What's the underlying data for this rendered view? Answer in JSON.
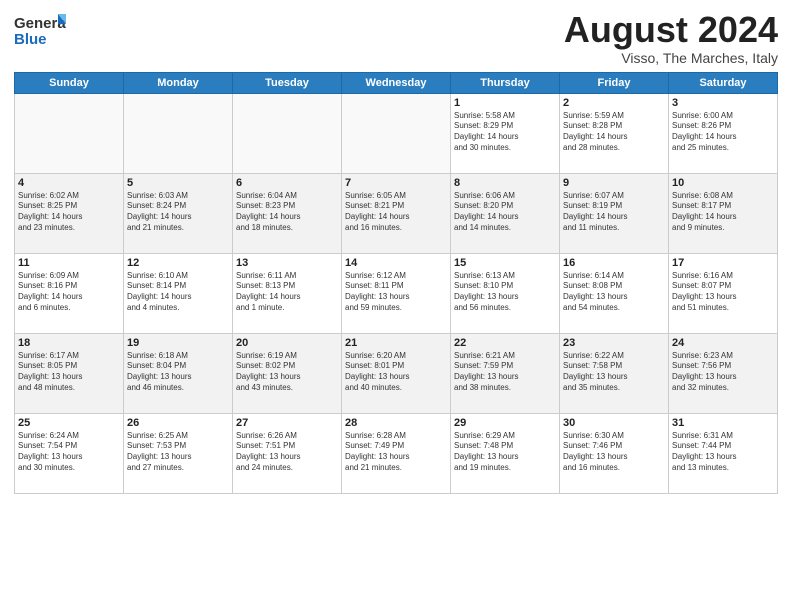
{
  "header": {
    "logo_general": "General",
    "logo_blue": "Blue",
    "month": "August 2024",
    "location": "Visso, The Marches, Italy"
  },
  "weekdays": [
    "Sunday",
    "Monday",
    "Tuesday",
    "Wednesday",
    "Thursday",
    "Friday",
    "Saturday"
  ],
  "weeks": [
    [
      {
        "day": "",
        "info": ""
      },
      {
        "day": "",
        "info": ""
      },
      {
        "day": "",
        "info": ""
      },
      {
        "day": "",
        "info": ""
      },
      {
        "day": "1",
        "info": "Sunrise: 5:58 AM\nSunset: 8:29 PM\nDaylight: 14 hours\nand 30 minutes."
      },
      {
        "day": "2",
        "info": "Sunrise: 5:59 AM\nSunset: 8:28 PM\nDaylight: 14 hours\nand 28 minutes."
      },
      {
        "day": "3",
        "info": "Sunrise: 6:00 AM\nSunset: 8:26 PM\nDaylight: 14 hours\nand 25 minutes."
      }
    ],
    [
      {
        "day": "4",
        "info": "Sunrise: 6:02 AM\nSunset: 8:25 PM\nDaylight: 14 hours\nand 23 minutes."
      },
      {
        "day": "5",
        "info": "Sunrise: 6:03 AM\nSunset: 8:24 PM\nDaylight: 14 hours\nand 21 minutes."
      },
      {
        "day": "6",
        "info": "Sunrise: 6:04 AM\nSunset: 8:23 PM\nDaylight: 14 hours\nand 18 minutes."
      },
      {
        "day": "7",
        "info": "Sunrise: 6:05 AM\nSunset: 8:21 PM\nDaylight: 14 hours\nand 16 minutes."
      },
      {
        "day": "8",
        "info": "Sunrise: 6:06 AM\nSunset: 8:20 PM\nDaylight: 14 hours\nand 14 minutes."
      },
      {
        "day": "9",
        "info": "Sunrise: 6:07 AM\nSunset: 8:19 PM\nDaylight: 14 hours\nand 11 minutes."
      },
      {
        "day": "10",
        "info": "Sunrise: 6:08 AM\nSunset: 8:17 PM\nDaylight: 14 hours\nand 9 minutes."
      }
    ],
    [
      {
        "day": "11",
        "info": "Sunrise: 6:09 AM\nSunset: 8:16 PM\nDaylight: 14 hours\nand 6 minutes."
      },
      {
        "day": "12",
        "info": "Sunrise: 6:10 AM\nSunset: 8:14 PM\nDaylight: 14 hours\nand 4 minutes."
      },
      {
        "day": "13",
        "info": "Sunrise: 6:11 AM\nSunset: 8:13 PM\nDaylight: 14 hours\nand 1 minute."
      },
      {
        "day": "14",
        "info": "Sunrise: 6:12 AM\nSunset: 8:11 PM\nDaylight: 13 hours\nand 59 minutes."
      },
      {
        "day": "15",
        "info": "Sunrise: 6:13 AM\nSunset: 8:10 PM\nDaylight: 13 hours\nand 56 minutes."
      },
      {
        "day": "16",
        "info": "Sunrise: 6:14 AM\nSunset: 8:08 PM\nDaylight: 13 hours\nand 54 minutes."
      },
      {
        "day": "17",
        "info": "Sunrise: 6:16 AM\nSunset: 8:07 PM\nDaylight: 13 hours\nand 51 minutes."
      }
    ],
    [
      {
        "day": "18",
        "info": "Sunrise: 6:17 AM\nSunset: 8:05 PM\nDaylight: 13 hours\nand 48 minutes."
      },
      {
        "day": "19",
        "info": "Sunrise: 6:18 AM\nSunset: 8:04 PM\nDaylight: 13 hours\nand 46 minutes."
      },
      {
        "day": "20",
        "info": "Sunrise: 6:19 AM\nSunset: 8:02 PM\nDaylight: 13 hours\nand 43 minutes."
      },
      {
        "day": "21",
        "info": "Sunrise: 6:20 AM\nSunset: 8:01 PM\nDaylight: 13 hours\nand 40 minutes."
      },
      {
        "day": "22",
        "info": "Sunrise: 6:21 AM\nSunset: 7:59 PM\nDaylight: 13 hours\nand 38 minutes."
      },
      {
        "day": "23",
        "info": "Sunrise: 6:22 AM\nSunset: 7:58 PM\nDaylight: 13 hours\nand 35 minutes."
      },
      {
        "day": "24",
        "info": "Sunrise: 6:23 AM\nSunset: 7:56 PM\nDaylight: 13 hours\nand 32 minutes."
      }
    ],
    [
      {
        "day": "25",
        "info": "Sunrise: 6:24 AM\nSunset: 7:54 PM\nDaylight: 13 hours\nand 30 minutes."
      },
      {
        "day": "26",
        "info": "Sunrise: 6:25 AM\nSunset: 7:53 PM\nDaylight: 13 hours\nand 27 minutes."
      },
      {
        "day": "27",
        "info": "Sunrise: 6:26 AM\nSunset: 7:51 PM\nDaylight: 13 hours\nand 24 minutes."
      },
      {
        "day": "28",
        "info": "Sunrise: 6:28 AM\nSunset: 7:49 PM\nDaylight: 13 hours\nand 21 minutes."
      },
      {
        "day": "29",
        "info": "Sunrise: 6:29 AM\nSunset: 7:48 PM\nDaylight: 13 hours\nand 19 minutes."
      },
      {
        "day": "30",
        "info": "Sunrise: 6:30 AM\nSunset: 7:46 PM\nDaylight: 13 hours\nand 16 minutes."
      },
      {
        "day": "31",
        "info": "Sunrise: 6:31 AM\nSunset: 7:44 PM\nDaylight: 13 hours\nand 13 minutes."
      }
    ]
  ]
}
